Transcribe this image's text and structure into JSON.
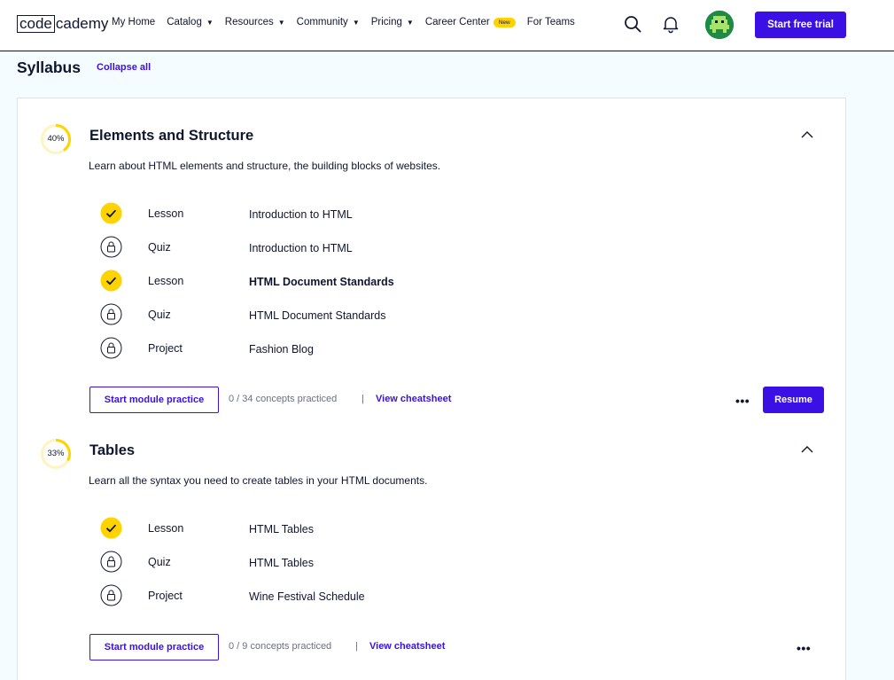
{
  "header": {
    "logo_box": "code",
    "logo_rest": "cademy",
    "nav": [
      {
        "label": "My Home",
        "dropdown": false
      },
      {
        "label": "Catalog",
        "dropdown": true
      },
      {
        "label": "Resources",
        "dropdown": true
      },
      {
        "label": "Community",
        "dropdown": true
      },
      {
        "label": "Pricing",
        "dropdown": true
      },
      {
        "label": "Career Center",
        "dropdown": false,
        "badge": "New"
      },
      {
        "label": "For Teams",
        "dropdown": false
      }
    ],
    "caret": "▼",
    "icons": {
      "search": "search-icon",
      "notifications": "bell-icon",
      "avatar": "avatar"
    },
    "trial_label": "Start free trial"
  },
  "syllabus": {
    "title": "Syllabus",
    "collapse_label": "Collapse all"
  },
  "modules": [
    {
      "progress_percent": 40,
      "progress_label": "40%",
      "title": "Elements and Structure",
      "description": "Learn about HTML elements and structure, the building blocks of websites.",
      "items": [
        {
          "status": "complete",
          "type": "Lesson",
          "name": "Introduction to HTML",
          "bold": false
        },
        {
          "status": "locked",
          "type": "Quiz",
          "name": "Introduction to HTML",
          "bold": false
        },
        {
          "status": "complete",
          "type": "Lesson",
          "name": "HTML Document Standards",
          "bold": true
        },
        {
          "status": "locked",
          "type": "Quiz",
          "name": "HTML Document Standards",
          "bold": false
        },
        {
          "status": "locked",
          "type": "Project",
          "name": "Fashion Blog",
          "bold": false
        }
      ],
      "practice_label": "Start module practice",
      "concepts": "0 / 34 concepts practiced",
      "separator": "|",
      "cheatsheet_label": "View cheatsheet",
      "more": "•••",
      "resume_label": "Resume"
    },
    {
      "progress_percent": 33,
      "progress_label": "33%",
      "title": "Tables",
      "description": "Learn all the syntax you need to create tables in your HTML documents.",
      "items": [
        {
          "status": "complete",
          "type": "Lesson",
          "name": "HTML Tables",
          "bold": false
        },
        {
          "status": "locked",
          "type": "Quiz",
          "name": "HTML Tables",
          "bold": false
        },
        {
          "status": "locked",
          "type": "Project",
          "name": "Wine Festival Schedule",
          "bold": false
        }
      ],
      "practice_label": "Start module practice",
      "concepts": "0 / 9 concepts practiced",
      "separator": "|",
      "cheatsheet_label": "View cheatsheet",
      "more": "•••"
    }
  ],
  "colors": {
    "accent": "#3a10e5",
    "complete": "#ffd300",
    "text": "#10162f",
    "muted": "#6b6f82",
    "page_bg": "#f5fcff"
  }
}
